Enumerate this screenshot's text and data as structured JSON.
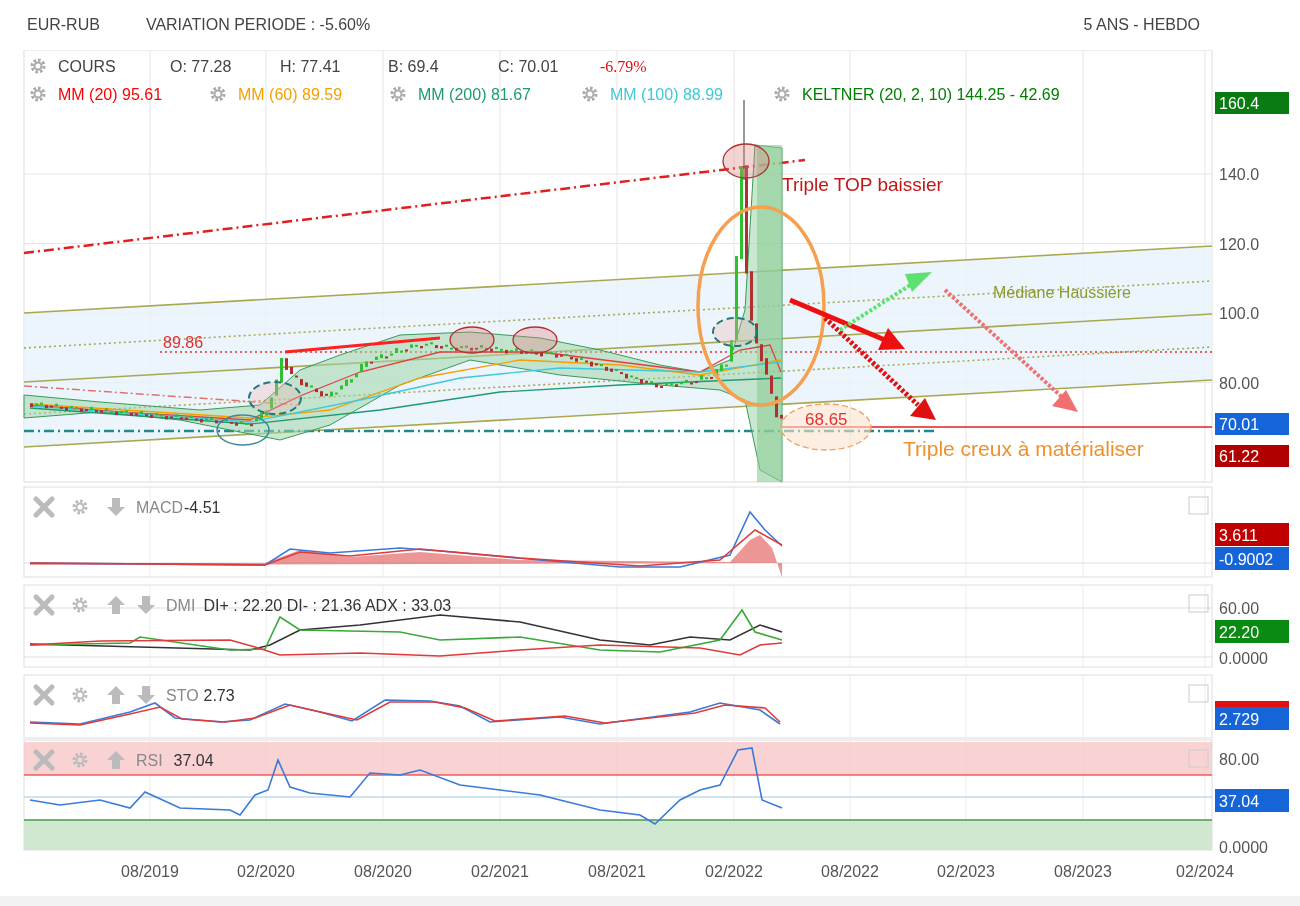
{
  "header": {
    "symbol": "EUR-RUB",
    "variation": "VARIATION PERIODE : -5.60%",
    "period": "5 ANS - HEBDO"
  },
  "main_chart": {
    "legend": {
      "label": "COURS",
      "fields": [
        "O: 77.28",
        "H: 77.41",
        "B: 69.4",
        "C: 70.01"
      ],
      "change": "-6.79%"
    },
    "indicators": [
      {
        "text": "MM (20) 95.61",
        "color": "#ff0000"
      },
      {
        "text": "MM (60) 89.59",
        "color": "#f5a000"
      },
      {
        "text": "MM (200) 81.67",
        "color": "#1e9a70"
      },
      {
        "text": "MM (100) 88.99",
        "color": "#3ec8d8"
      },
      {
        "text": "KELTNER (20, 2, 10) 144.25 - 42.69",
        "color": "#008000"
      }
    ],
    "y_axis_labels": [
      "140.0",
      "120.0",
      "100.0",
      "80.00"
    ],
    "price_tags": [
      {
        "text": "160.4",
        "color": "#0a7a12"
      },
      {
        "text": "70.01",
        "color": "#1565d8"
      },
      {
        "text": "61.22",
        "color": "#b00000"
      }
    ],
    "annotations": [
      {
        "kind": "level",
        "text": "89.86"
      },
      {
        "kind": "callout",
        "text": "Triple TOP baissier"
      },
      {
        "kind": "trend",
        "text": "Médiane Haussière"
      },
      {
        "kind": "target",
        "text": "68.65"
      },
      {
        "kind": "objective",
        "text": "Triple creux à matérialiser"
      }
    ]
  },
  "panels": [
    {
      "kind": "macd",
      "name": "MACD",
      "values": "-4.51",
      "can_move_up": false,
      "can_move_down": true,
      "checked": false,
      "price_tags": [
        {
          "text": "3.611",
          "color": "#c00000"
        },
        {
          "text": "-0.9002",
          "color": "#1565d8"
        }
      ]
    },
    {
      "kind": "dmi",
      "name": "DMI",
      "values": "DI+ : 22.20 DI- : 21.36 ADX : 33.03",
      "can_move_up": true,
      "can_move_down": true,
      "checked": false,
      "axis_labels": [
        "60.00",
        "0.0000"
      ],
      "price_tags": [
        {
          "text": "22.20",
          "color": "#0a8a12"
        }
      ]
    },
    {
      "kind": "sto",
      "name": "STO",
      "values": "2.73",
      "can_move_up": true,
      "can_move_down": true,
      "checked": false,
      "price_tags": [
        {
          "text": "2.729",
          "color": "#1565d8"
        }
      ]
    },
    {
      "kind": "rsi",
      "name": "RSI",
      "values": "37.04",
      "can_move_up": true,
      "can_move_down": false,
      "checked": false,
      "axis_labels": [
        "80.00",
        "0.0000"
      ],
      "price_tags": [
        {
          "text": "37.04",
          "color": "#1565d8"
        }
      ]
    }
  ],
  "x_axis_labels": [
    "08/2019",
    "02/2020",
    "08/2020",
    "02/2021",
    "08/2021",
    "02/2022",
    "08/2022",
    "02/2023",
    "08/2023",
    "02/2024"
  ]
}
